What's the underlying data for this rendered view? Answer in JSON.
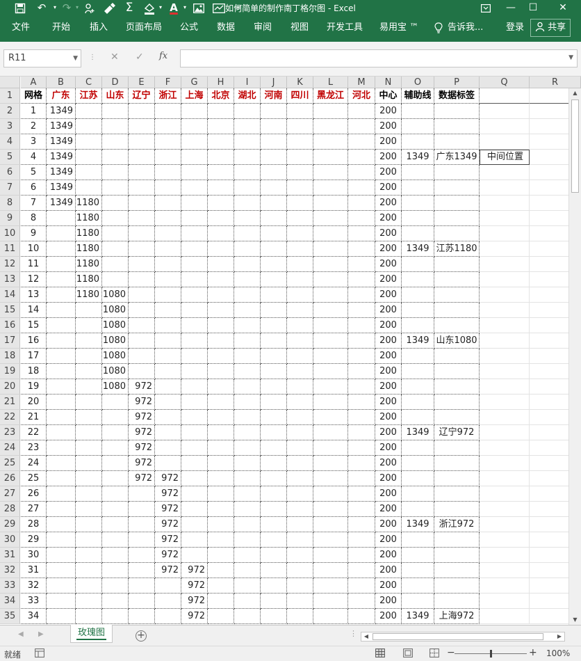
{
  "window": {
    "title": "如何简单的制作南丁格尔图 - Excel",
    "quick_access": {
      "save_icon": "save-icon",
      "undo_icon": "undo-icon",
      "redo_icon": "redo-icon",
      "touch_icon": "touch-mode-icon",
      "brush_icon": "format-painter-icon",
      "sum_icon": "autosum-icon",
      "fill_icon": "fill-color-icon",
      "font_color_label": "A",
      "picture_icon": "picture-icon",
      "chart_icon": "chart-icon",
      "customize_label": "="
    },
    "controls": {
      "ribbon_options_icon": "ribbon-display-icon",
      "minimize_label": "—",
      "maximize_label": "☐",
      "close_label": "✕"
    }
  },
  "ribbon": {
    "tabs": [
      "文件",
      "开始",
      "插入",
      "页面布局",
      "公式",
      "数据",
      "审阅",
      "视图",
      "开发工具",
      "易用宝 ™"
    ],
    "tell_me": "告诉我...",
    "login": "登录",
    "share": "共享"
  },
  "formula_bar": {
    "name_box": "R11",
    "cancel_label": "✕",
    "enter_label": "✓",
    "fx_label": "fx",
    "value": ""
  },
  "grid": {
    "columns": [
      "A",
      "B",
      "C",
      "D",
      "E",
      "F",
      "G",
      "H",
      "I",
      "J",
      "K",
      "L",
      "M",
      "N",
      "O",
      "P",
      "Q",
      "R"
    ],
    "header_row": [
      "网格",
      "广东",
      "江苏",
      "山东",
      "辽宁",
      "浙江",
      "上海",
      "北京",
      "湖北",
      "河南",
      "四川",
      "黑龙江",
      "河北",
      "中心",
      "辅助线",
      "数据标签"
    ],
    "red_header_cols": [
      "B",
      "C",
      "D",
      "E",
      "F",
      "G",
      "H",
      "I",
      "J",
      "K",
      "L",
      "M"
    ],
    "rows": [
      {
        "n": "2",
        "A": "1",
        "B": "1349",
        "N": "200"
      },
      {
        "n": "3",
        "A": "2",
        "B": "1349",
        "N": "200"
      },
      {
        "n": "4",
        "A": "3",
        "B": "1349",
        "N": "200"
      },
      {
        "n": "5",
        "A": "4",
        "B": "1349",
        "N": "200",
        "O": "1349",
        "P": "广东1349",
        "Q": "中间位置"
      },
      {
        "n": "6",
        "A": "5",
        "B": "1349",
        "N": "200"
      },
      {
        "n": "7",
        "A": "6",
        "B": "1349",
        "N": "200"
      },
      {
        "n": "8",
        "A": "7",
        "B": "1349",
        "C": "1180",
        "N": "200"
      },
      {
        "n": "9",
        "A": "8",
        "C": "1180",
        "N": "200"
      },
      {
        "n": "10",
        "A": "9",
        "C": "1180",
        "N": "200"
      },
      {
        "n": "11",
        "A": "10",
        "C": "1180",
        "N": "200",
        "O": "1349",
        "P": "江苏1180"
      },
      {
        "n": "12",
        "A": "11",
        "C": "1180",
        "N": "200"
      },
      {
        "n": "13",
        "A": "12",
        "C": "1180",
        "N": "200"
      },
      {
        "n": "14",
        "A": "13",
        "C": "1180",
        "D": "1080",
        "N": "200"
      },
      {
        "n": "15",
        "A": "14",
        "D": "1080",
        "N": "200"
      },
      {
        "n": "16",
        "A": "15",
        "D": "1080",
        "N": "200"
      },
      {
        "n": "17",
        "A": "16",
        "D": "1080",
        "N": "200",
        "O": "1349",
        "P": "山东1080"
      },
      {
        "n": "18",
        "A": "17",
        "D": "1080",
        "N": "200"
      },
      {
        "n": "19",
        "A": "18",
        "D": "1080",
        "N": "200"
      },
      {
        "n": "20",
        "A": "19",
        "D": "1080",
        "E": "972",
        "N": "200"
      },
      {
        "n": "21",
        "A": "20",
        "E": "972",
        "N": "200"
      },
      {
        "n": "22",
        "A": "21",
        "E": "972",
        "N": "200"
      },
      {
        "n": "23",
        "A": "22",
        "E": "972",
        "N": "200",
        "O": "1349",
        "P": "辽宁972"
      },
      {
        "n": "24",
        "A": "23",
        "E": "972",
        "N": "200"
      },
      {
        "n": "25",
        "A": "24",
        "E": "972",
        "N": "200"
      },
      {
        "n": "26",
        "A": "25",
        "E": "972",
        "F": "972",
        "N": "200"
      },
      {
        "n": "27",
        "A": "26",
        "F": "972",
        "N": "200"
      },
      {
        "n": "28",
        "A": "27",
        "F": "972",
        "N": "200"
      },
      {
        "n": "29",
        "A": "28",
        "F": "972",
        "N": "200",
        "O": "1349",
        "P": "浙江972"
      },
      {
        "n": "30",
        "A": "29",
        "F": "972",
        "N": "200"
      },
      {
        "n": "31",
        "A": "30",
        "F": "972",
        "N": "200"
      },
      {
        "n": "32",
        "A": "31",
        "F": "972",
        "G": "972",
        "N": "200"
      },
      {
        "n": "33",
        "A": "32",
        "G": "972",
        "N": "200"
      },
      {
        "n": "34",
        "A": "33",
        "G": "972",
        "N": "200"
      },
      {
        "n": "35",
        "A": "34",
        "G": "972",
        "N": "200",
        "O": "1349",
        "P": "上海972"
      }
    ]
  },
  "sheets": {
    "active": "玫瑰图",
    "add_label": "+"
  },
  "status": {
    "ready": "就绪",
    "zoom": "100%",
    "zoom_out": "−",
    "zoom_in": "+"
  }
}
